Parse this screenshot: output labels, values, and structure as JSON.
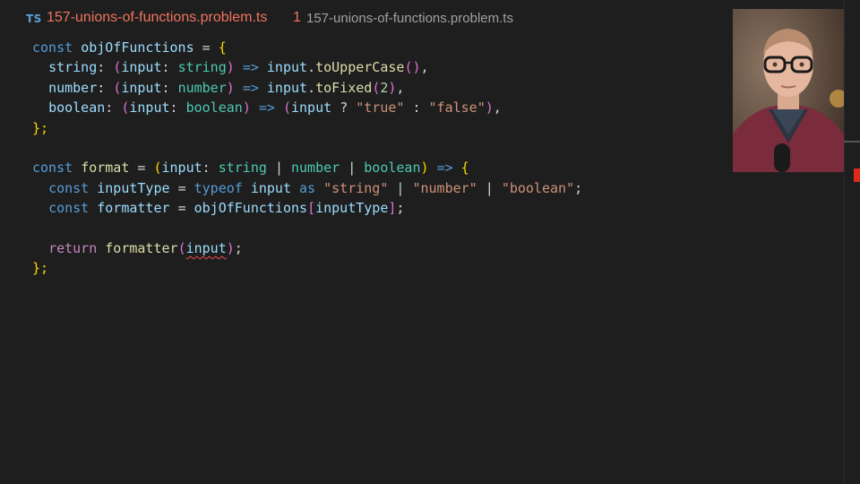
{
  "tab": {
    "lang_badge": "TS",
    "filename": "157-unions-of-functions.problem.ts",
    "problem_count": "1",
    "path": "157-unions-of-functions.problem.ts"
  },
  "colors": {
    "error": "#f14c4c",
    "background": "#1e1e1e"
  },
  "code": {
    "l1": {
      "k": "const",
      "n": "objOfFunctions",
      "eq": "=",
      "br": "{"
    },
    "l2": {
      "p": "string",
      "a": "input",
      "t": "string",
      "arrow": "=>",
      "o": "input",
      "m": "toUpperCase",
      "end": ","
    },
    "l3": {
      "p": "number",
      "a": "input",
      "t": "number",
      "arrow": "=>",
      "o": "input",
      "m": "toFixed",
      "arg": "2",
      "end": ","
    },
    "l4": {
      "p": "boolean",
      "a": "input",
      "t": "boolean",
      "arrow": "=>",
      "o": "input",
      "q": "?",
      "s1": "\"true\"",
      "c": ":",
      "s2": "\"false\"",
      "end": ","
    },
    "l5": {
      "br": "};"
    },
    "l7": {
      "k": "const",
      "n": "format",
      "eq": "=",
      "a": "input",
      "t1": "string",
      "bar": "|",
      "t2": "number",
      "t3": "boolean",
      "arrow": "=>",
      "br": "{"
    },
    "l8": {
      "k": "const",
      "n": "inputType",
      "eq": "=",
      "typeof": "typeof",
      "o": "input",
      "as": "as",
      "s1": "\"string\"",
      "bar": "|",
      "s2": "\"number\"",
      "s3": "\"boolean\"",
      "semi": ";"
    },
    "l9": {
      "k": "const",
      "n": "formatter",
      "eq": "=",
      "obj": "objOfFunctions",
      "idx": "inputType",
      "semi": ";"
    },
    "l11": {
      "ret": "return",
      "fn": "formatter",
      "arg": "input",
      "semi": ";"
    },
    "l12": {
      "br": "};"
    }
  }
}
